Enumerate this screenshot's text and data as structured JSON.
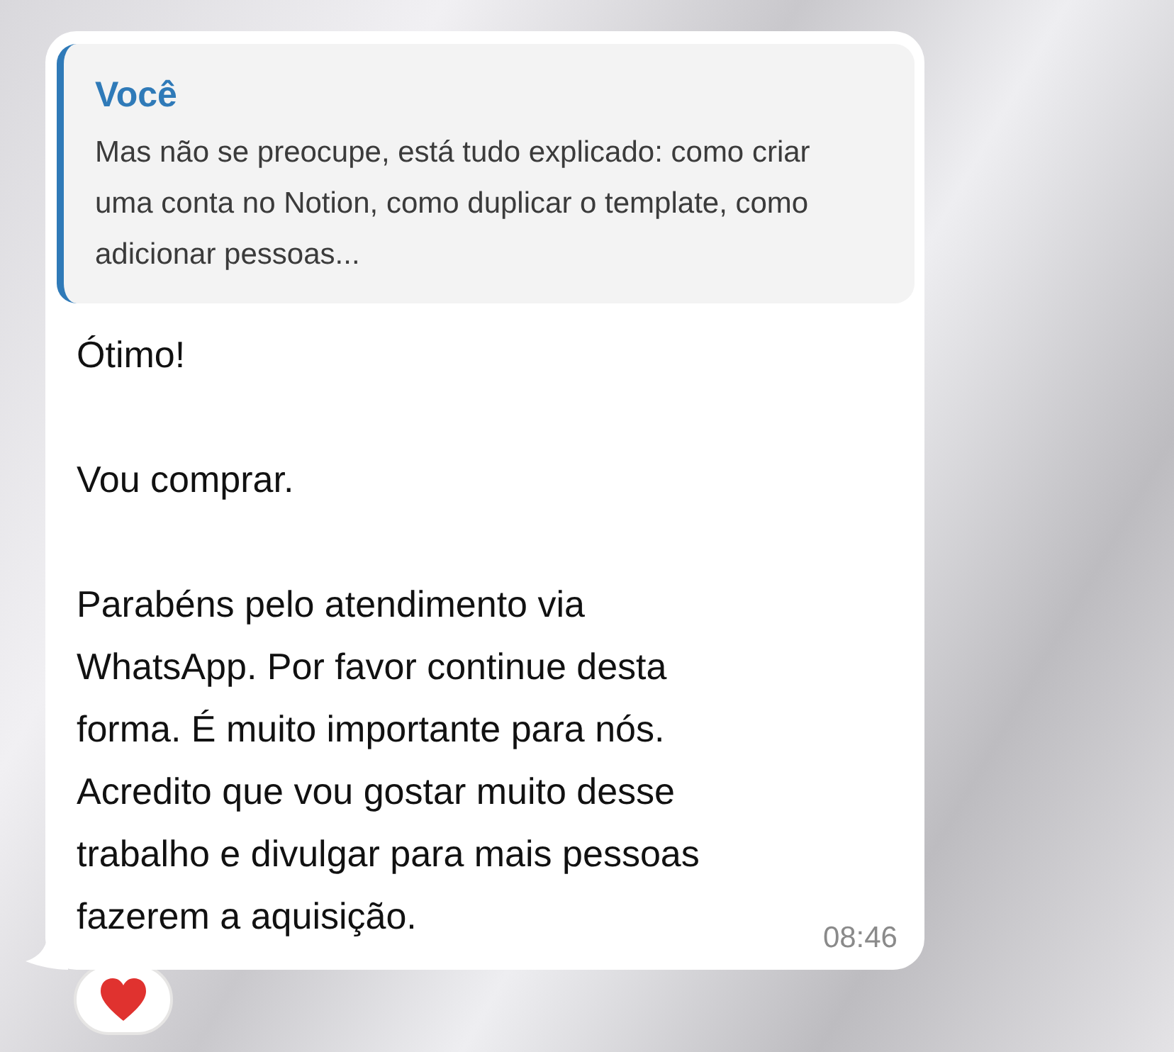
{
  "message": {
    "quote": {
      "author": "Você",
      "text": "Mas não se preocupe, está tudo explicado: como criar uma conta no Notion, como duplicar o template, como adicionar pessoas..."
    },
    "paragraphs": [
      "Ótimo!",
      "Vou comprar.",
      "Parabéns pelo atendimento via WhatsApp. Por favor continue desta forma. É muito importante para nós. Acredito que vou gostar muito desse trabalho e divulgar para mais pessoas fazerem a aquisição."
    ],
    "time": "08:46",
    "reaction": {
      "kind": "heart"
    }
  }
}
